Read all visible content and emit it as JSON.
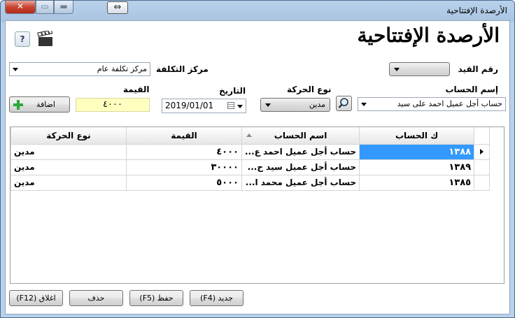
{
  "window": {
    "title": "الأرصدة الإفتتاحية",
    "close_glyph": "✕",
    "max_glyph": "▭",
    "min_glyph": "▬",
    "restore_glyph": "⇔"
  },
  "header": {
    "heading": "الأرصدة الإفتتاحية",
    "help_glyph": "?"
  },
  "form": {
    "entry_no_label": "رقم القيد",
    "entry_no_value": "",
    "cost_center_label": "مركز التكلفة",
    "cost_center_value": "مركز تكلفة عام",
    "account_name_label": "إسم الحساب",
    "account_name_value": "حساب أجل عميل احمد على سيد",
    "movement_type_label": "نوع الحركة",
    "movement_type_value": "مدين",
    "date_label": "التاريخ",
    "date_value": "2019/01/01",
    "amount_label": "القيمة",
    "amount_value": "٤٠٠٠",
    "add_button": "اضافة"
  },
  "grid": {
    "columns": [
      "ك الحساب",
      "اسم الحساب",
      "القيمة",
      "نوع الحركة"
    ],
    "rows": [
      {
        "code": "١٣٨٨",
        "name": "حساب أجل عميل احمد ع...",
        "amount": "٤٠٠٠",
        "type": "مدين"
      },
      {
        "code": "١٣٨٩",
        "name": "حساب أجل عميل سيد ح...",
        "amount": "٣٠٠٠٠",
        "type": "مدين"
      },
      {
        "code": "١٣٨٥",
        "name": "حساب أجل عميل محمد ا...",
        "amount": "٥٠٠٠",
        "type": "مدين"
      }
    ]
  },
  "footer": {
    "new_button": "جديد (F4)",
    "save_button": "حفظ (F5)",
    "delete_button": "حذف",
    "close_button": "اغلاق (F12)"
  },
  "colors": {
    "selection": "#3399ff",
    "amount_highlight": "#ffffc0",
    "titlebar": "#b9d1ea"
  }
}
